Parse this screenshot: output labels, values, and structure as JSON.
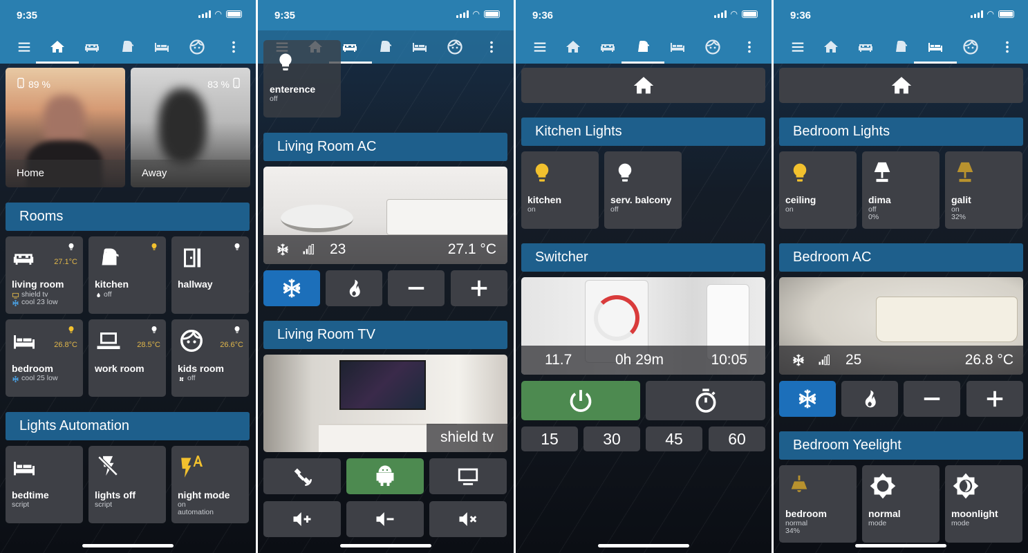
{
  "status": {
    "p1": "9:35",
    "p2": "9:35",
    "p3": "9:36",
    "p4": "9:36"
  },
  "colors": {
    "accent": "#2a7fb0",
    "header": "#1e5f8c",
    "card": "#3e4046",
    "active_blue": "#1c6fba",
    "active_green": "#4d8a50",
    "bulb_on": "#f2c12e"
  },
  "nav_icons": [
    "menu-icon",
    "home-icon",
    "sofa-icon",
    "kettle-icon",
    "bed-icon",
    "face-icon",
    "more-icon"
  ],
  "screen1": {
    "people": [
      {
        "label": "Home",
        "battery": "89 %"
      },
      {
        "label": "Away",
        "battery": "83 %"
      }
    ],
    "rooms_header": "Rooms",
    "rooms": [
      {
        "name": "living room",
        "temp": "27.1°C",
        "line1": "shield tv",
        "line2": "cool 23 low",
        "icon": "sofa-icon"
      },
      {
        "name": "kitchen",
        "temp": "",
        "line1": "off",
        "line2": "",
        "icon": "kettle-icon"
      },
      {
        "name": "hallway",
        "temp": "",
        "line1": "",
        "line2": "",
        "icon": "door-icon"
      },
      {
        "name": "bedroom",
        "temp": "26.8°C",
        "line1": "cool 25 low",
        "line2": "",
        "icon": "bed-icon"
      },
      {
        "name": "work room",
        "temp": "28.5°C",
        "line1": "",
        "line2": "",
        "icon": "laptop-icon"
      },
      {
        "name": "kids room",
        "temp": "26.6°C",
        "line1": "off",
        "line2": "",
        "icon": "face-icon"
      }
    ],
    "automation_header": "Lights Automation",
    "automations": [
      {
        "name": "bedtime",
        "sub": "script"
      },
      {
        "name": "lights off",
        "sub": "script"
      },
      {
        "name": "night mode",
        "sub": "on",
        "sub2": "automation"
      }
    ]
  },
  "screen2": {
    "entrance": {
      "name": "enterence",
      "state": "off"
    },
    "ac_header": "Living Room AC",
    "ac": {
      "setpoint": "23",
      "temperature": "27.1 °C"
    },
    "tv_header": "Living Room TV",
    "tv": {
      "label": "shield tv"
    }
  },
  "screen3": {
    "kitchen_header": "Kitchen Lights",
    "lights": [
      {
        "name": "kitchen",
        "state": "on"
      },
      {
        "name": "serv. balcony",
        "state": "off"
      }
    ],
    "switcher_header": "Switcher",
    "switcher": {
      "power": "11.7",
      "remaining": "0h 29m",
      "time": "10:05"
    },
    "timers": [
      "15",
      "30",
      "45",
      "60"
    ]
  },
  "screen4": {
    "lights_header": "Bedroom Lights",
    "lights": [
      {
        "name": "ceiling",
        "state": "on",
        "level": ""
      },
      {
        "name": "dima",
        "state": "off",
        "level": "0%"
      },
      {
        "name": "galit",
        "state": "on",
        "level": "32%"
      }
    ],
    "ac_header": "Bedroom AC",
    "ac": {
      "setpoint": "25",
      "temperature": "26.8 °C"
    },
    "yeelight_header": "Bedroom Yeelight",
    "yeelights": [
      {
        "name": "bedroom",
        "sub": "normal",
        "sub2": "34%"
      },
      {
        "name": "normal",
        "sub": "mode",
        "sub2": ""
      },
      {
        "name": "moonlight",
        "sub": "mode",
        "sub2": ""
      }
    ]
  }
}
